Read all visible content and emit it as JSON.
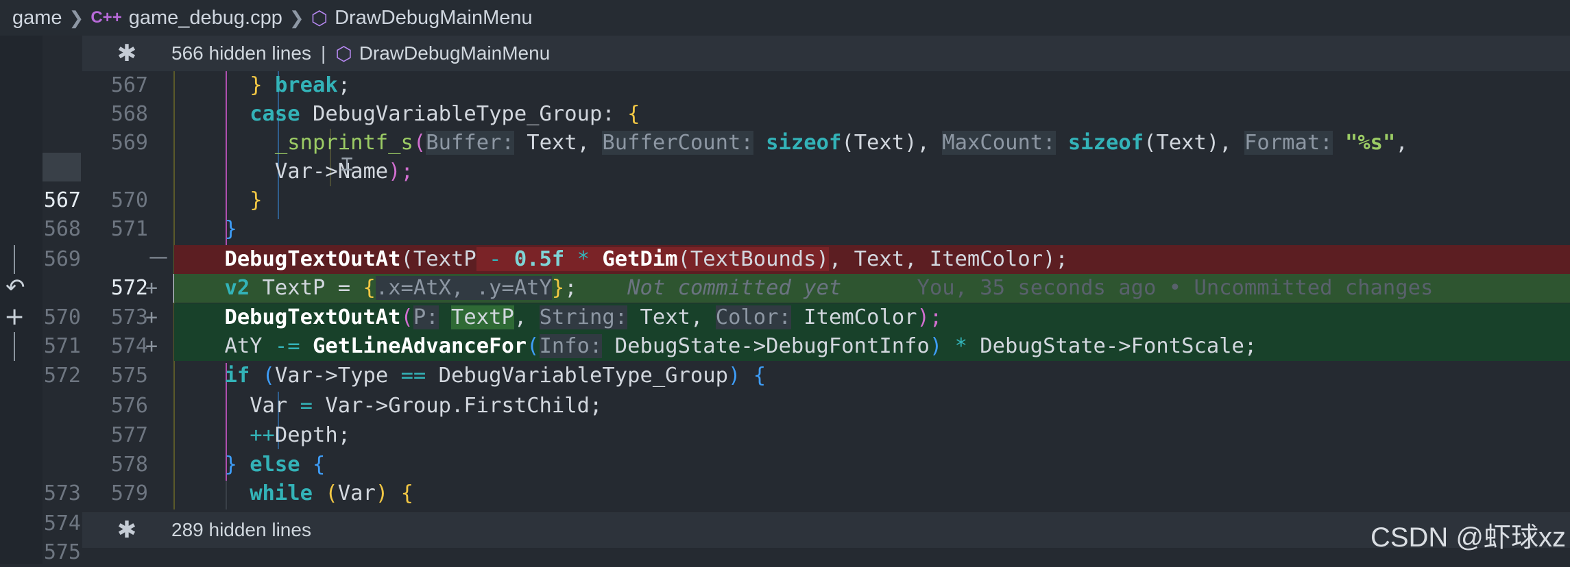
{
  "breadcrumb": {
    "root": "game",
    "file_icon": "C++",
    "file": "game_debug.cpp",
    "symbol": "DrawDebugMainMenu"
  },
  "sticky_top": {
    "hidden": "566 hidden lines",
    "sep": "|",
    "symbol": "DrawDebugMainMenu"
  },
  "sticky_bottom": {
    "hidden": "289 hidden lines"
  },
  "old_lines": [
    "567",
    "568",
    "569",
    "570",
    "571",
    "572",
    "573",
    "574",
    "575"
  ],
  "new_lines": [
    "567",
    "568",
    "569",
    "570",
    "571",
    "572",
    "573",
    "574",
    "575",
    "576",
    "577",
    "578",
    "579"
  ],
  "plus": [
    "+",
    "+",
    "+"
  ],
  "minus": "—",
  "code": {
    "l567": {
      "brace": "}",
      "kw": "break",
      "semi": ";"
    },
    "l568": {
      "kw": "case",
      "type": "DebugVariableType_Group",
      "colon": ":",
      "brace": "{"
    },
    "l569": {
      "fn": "_snprintf_s",
      "p": "(",
      "h1": "Buffer:",
      "a1": "Text",
      "c1": ",",
      "h2": "BufferCount:",
      "kw2": "sizeof",
      "a2": "(Text)",
      "c2": ",",
      "h3": "MaxCount:",
      "kw3": "sizeof",
      "a3": "(Text)",
      "c3": ",",
      "h4": "Format:",
      "s": "\"%s\"",
      "c4": ","
    },
    "l569b": {
      "text": "Var->Name",
      "end": ");"
    },
    "l570": {
      "brace": "}"
    },
    "l571": {
      "brace": "}"
    },
    "del": {
      "fn": "DebugTextOutAt",
      "a": "(TextP",
      "hl": " - ",
      "num": "0.5f",
      "star": " * ",
      "fn2": "GetDim",
      "b": "(TextBounds)",
      "rest": ", Text, ItemColor);"
    },
    "l572": {
      "type": "v2",
      "a": " TextP = ",
      "b1": "{",
      "x": ".x=AtX, ",
      "y": ".y=AtY",
      "b2": "}",
      "end": ";",
      "blame": "Not committed yet",
      "blame2": "You, 35 seconds ago • Uncommitted changes"
    },
    "l573": {
      "fn": "DebugTextOutAt",
      "p": "(",
      "h1": "P:",
      "a1": "TextP",
      "c1": ",",
      "h2": "String:",
      "a2": "Text",
      "c2": ",",
      "h3": "Color:",
      "a3": "ItemColor",
      "end": ");"
    },
    "l574": {
      "a": "AtY",
      "op": " -= ",
      "fn": "GetLineAdvanceFor",
      "p": "(",
      "h1": "Info:",
      "a1": "DebugState->DebugFontInfo",
      "pc": ")",
      "star": " * ",
      "a2": "DebugState->FontScale",
      "end": ";"
    },
    "l575": {
      "kw": "if",
      "p": "(",
      "a": "Var->Type",
      "op": " == ",
      "b": "DebugVariableType_Group",
      "pc": ")",
      "brace": "{"
    },
    "l576": {
      "a": "Var",
      "op": " = ",
      "b": "Var->Group.FirstChild",
      "end": ";"
    },
    "l577": {
      "op": "++",
      "a": "Depth",
      "end": ";"
    },
    "l578": {
      "b1": "}",
      "kw": "else",
      "b2": "{"
    },
    "l579": {
      "kw": "while",
      "p": "(",
      "a": "Var",
      "pc": ")",
      "brace": "{"
    }
  },
  "watermark": "CSDN @虾球xz",
  "colors": {
    "deleted": "#5c1e22",
    "added": "#18412a",
    "keyword": "#33b3b8"
  }
}
